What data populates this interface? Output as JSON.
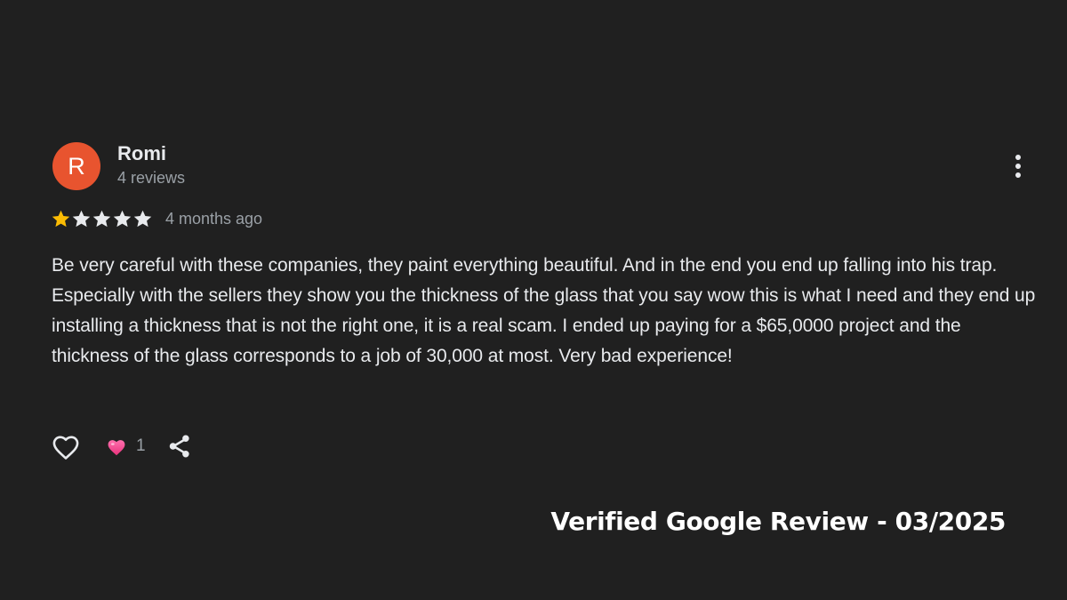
{
  "review": {
    "author": {
      "initial": "R",
      "name": "Romi",
      "review_count": "4 reviews",
      "avatar_color": "#e8542f"
    },
    "rating": 1,
    "rating_max": 5,
    "time_ago": "4 months ago",
    "text": "Be very careful with these companies, they paint everything beautiful. And in the end you end up falling into his trap. Especially with the sellers they show you the thickness of the glass that you say wow this is what I need and they end up installing a thickness that is not the right one, it is a real scam. I ended up paying for a $65,0000 project and the thickness of the glass corresponds to a job of 30,000 at most. Very bad experience!",
    "reaction_count": "1",
    "icons": {
      "more": "more-vert-icon",
      "like": "heart-outline-icon",
      "reaction": "pink-heart-icon",
      "share": "share-icon"
    },
    "colors": {
      "star_filled": "#fbbc04",
      "star_empty": "#e8eaed",
      "background": "#202020"
    }
  },
  "caption": "Verified Google Review - 03/2025"
}
